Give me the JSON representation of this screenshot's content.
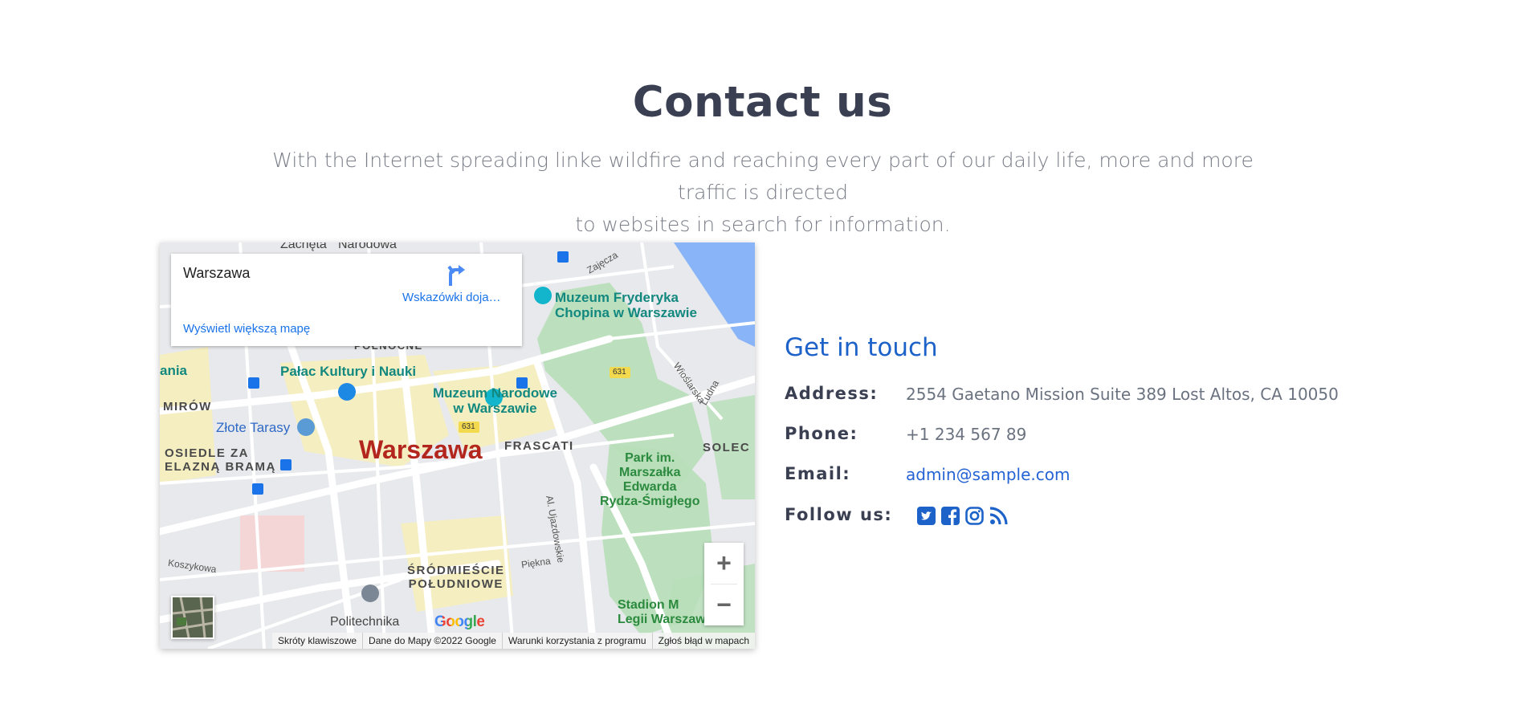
{
  "section": {
    "title": "Contact us",
    "subtitle_line1": "With the Internet spreading linke wildfire and reaching every part of our daily life, more and more traffic is directed",
    "subtitle_line2": "to websites in search for information."
  },
  "map": {
    "infobox": {
      "place": "Warszawa",
      "directions_label": "Wskazówki doja…",
      "bigger_map_link": "Wyświetl większą mapę"
    },
    "labels": {
      "city": "Warszawa",
      "palac": "Pałac Kultury i Nauki",
      "muzeum_narodowe_1": "Muzeum Narodowe",
      "muzeum_narodowe_2": "w Warszawie",
      "muzeum_chopina_1": "Muzeum Fryderyka",
      "muzeum_chopina_2": "Chopina w Warszawie",
      "zlote_tarasy": "Złote Tarasy",
      "frascati": "FRASCATI",
      "solec": "SOLEC",
      "park_1": "Park im.",
      "park_2": "Marszałka",
      "park_3": "Edwarda",
      "park_4": "Rydza-Śmigłego",
      "osiedle_1": "OSIEDLE ZA",
      "osiedle_2": "ELAZNĄ BRAMĄ",
      "mirow": "MIRÓW",
      "ania": "ania",
      "polnocne": "PÓŁNOCNE",
      "srodmiescie_1": "ŚRÓDMIEŚCIE",
      "srodmiescie_2": "POŁUDNIOWE",
      "politechnika": "Politechnika",
      "stadion_1": "Stadion M",
      "stadion_2": "Legii Warszawa i...",
      "zacheta": "Zachęta",
      "narodowa": "Narodowa",
      "zajecza": "Zajęcza",
      "wioslarska": "Wioślarska",
      "ludna": "Ludna",
      "koszykowa": "Koszykowa",
      "piekna": "Piękna",
      "ujazdowskie": "Al. Ujazdowskie",
      "road_631_a": "631",
      "road_631_b": "631"
    },
    "zoom_in": "+",
    "zoom_out": "−",
    "google_logo": "Google",
    "attribution": [
      "Skróty klawiszowe",
      "Dane do Mapy ©2022 Google",
      "Warunki korzystania z programu",
      "Zgłoś błąd w mapach"
    ]
  },
  "contact": {
    "title": "Get in touch",
    "address_label": "Address:",
    "address_value": "2554 Gaetano Mission Suite 389 Lost Altos, CA 10050",
    "phone_label": "Phone:",
    "phone_value": "+1 234 567 89",
    "email_label": "Email:",
    "email_value": "admin@sample.com",
    "follow_label": "Follow us:",
    "social_icons": [
      "twitter-icon",
      "facebook-icon",
      "instagram-icon",
      "rss-icon"
    ],
    "accent_color": "#1d62c8"
  }
}
